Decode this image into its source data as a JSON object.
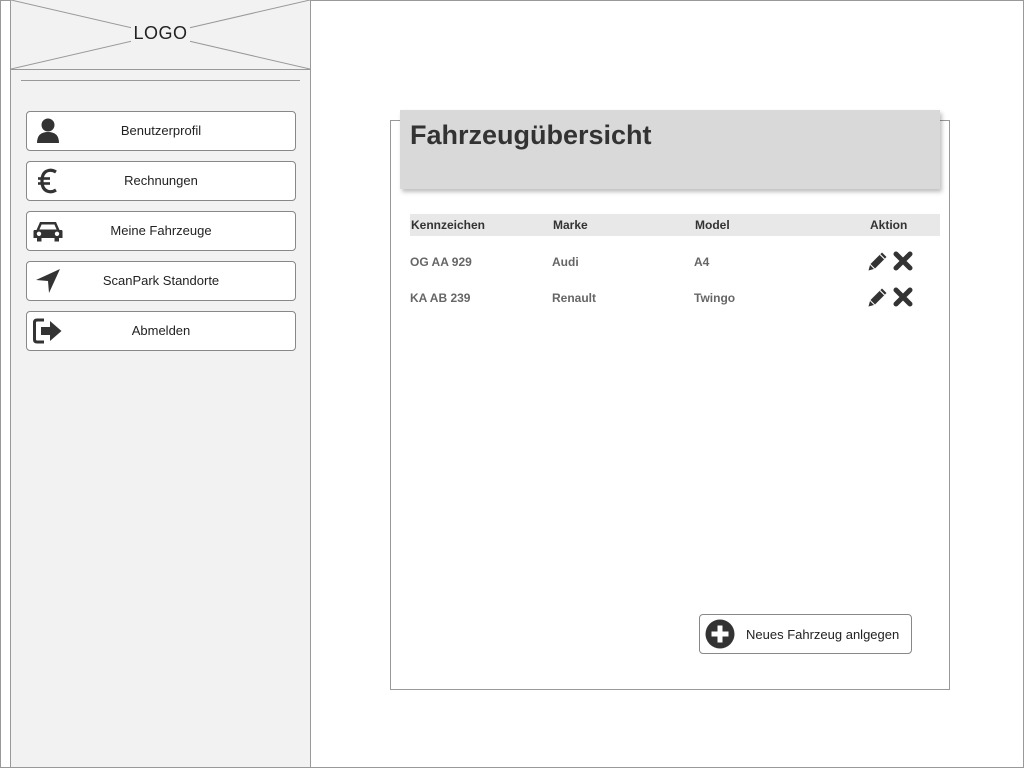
{
  "logo": {
    "text": "LOGO"
  },
  "sidebar": {
    "items": [
      {
        "label": "Benutzerprofil",
        "icon": "user-icon"
      },
      {
        "label": "Rechnungen",
        "icon": "euro-icon"
      },
      {
        "label": "Meine Fahrzeuge",
        "icon": "car-icon"
      },
      {
        "label": "ScanPark Standorte",
        "icon": "location-arrow-icon"
      },
      {
        "label": "Abmelden",
        "icon": "sign-out-icon"
      }
    ]
  },
  "main": {
    "title": "Fahrzeugübersicht",
    "table": {
      "columns": [
        "Kennzeichen",
        "Marke",
        "Model",
        "Aktion"
      ],
      "rows": [
        {
          "plate": "OG AA 929",
          "brand": "Audi",
          "model": "A4"
        },
        {
          "plate": "KA AB 239",
          "brand": "Renault",
          "model": "Twingo"
        }
      ]
    },
    "new_vehicle_button": {
      "label": "Neues Fahrzeug anlgegen",
      "icon": "plus-circle-icon"
    }
  },
  "colors": {
    "sidebar_bg": "#f2f2f2",
    "title_bg": "#d9d9d9",
    "table_header_bg": "#e8e8e8",
    "icon_dark": "#333333"
  }
}
